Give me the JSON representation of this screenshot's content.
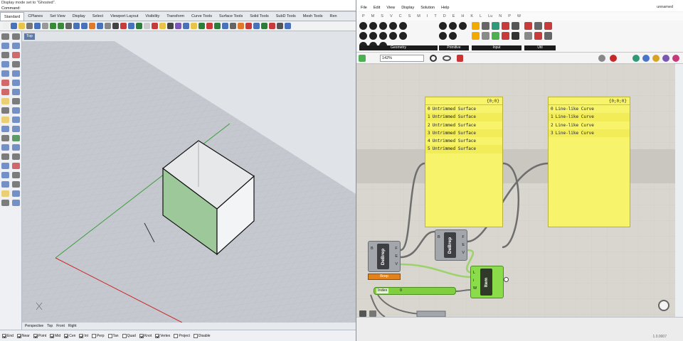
{
  "rhino": {
    "command_history": "Display mode set to \"Ghosted\".",
    "command_prompt": "Command:",
    "tabs": [
      "Standard",
      "CPlanes",
      "Set View",
      "Display",
      "Select",
      "Viewport Layout",
      "Visibility",
      "Transform",
      "Curve Tools",
      "Surface Tools",
      "Solid Tools",
      "SubD Tools",
      "Mesh Tools",
      "Ren"
    ],
    "viewport_title": "Top",
    "viewport_tabs": [
      "Perspective",
      "Top",
      "Front",
      "Right"
    ],
    "osnaps": [
      {
        "label": "End",
        "checked": true
      },
      {
        "label": "Near",
        "checked": true
      },
      {
        "label": "Point",
        "checked": true
      },
      {
        "label": "Mid",
        "checked": true
      },
      {
        "label": "Cen",
        "checked": true
      },
      {
        "label": "Int",
        "checked": true
      },
      {
        "label": "Perp",
        "checked": false
      },
      {
        "label": "Tan",
        "checked": false
      },
      {
        "label": "Quad",
        "checked": false
      },
      {
        "label": "Knot",
        "checked": true
      },
      {
        "label": "Vertex",
        "checked": true
      },
      {
        "label": "Project",
        "checked": false
      },
      {
        "label": "Disable",
        "checked": false
      }
    ]
  },
  "grasshopper": {
    "menu": [
      "File",
      "Edit",
      "View",
      "Display",
      "Solution",
      "Help"
    ],
    "document_name": "unnamed",
    "ribbon_groups": [
      "Geometry",
      "Primitive",
      "Input",
      "Util"
    ],
    "zoom": "142%",
    "panel_left": {
      "path": "{0;0}",
      "rows": [
        "Untrimmed Surface",
        "Untrimmed Surface",
        "Untrimmed Surface",
        "Untrimmed Surface",
        "Untrimmed Surface",
        "Untrimmed Surface"
      ]
    },
    "panel_right": {
      "path": "{0;0;0}",
      "rows": [
        "Line-like Curve",
        "Line-like Curve",
        "Line-like Curve",
        "Line-like Curve"
      ]
    },
    "debrep_label": "DeBrep",
    "debrep_inputs": [
      "B"
    ],
    "debrep_outputs": [
      "F",
      "E",
      "V"
    ],
    "debrep_badge": "Brep",
    "index_slider": {
      "label": "Index",
      "value": "0"
    },
    "item": {
      "label": "Item",
      "inputs": [
        "L",
        "i",
        "W"
      ]
    },
    "version": "1.0.0007"
  }
}
